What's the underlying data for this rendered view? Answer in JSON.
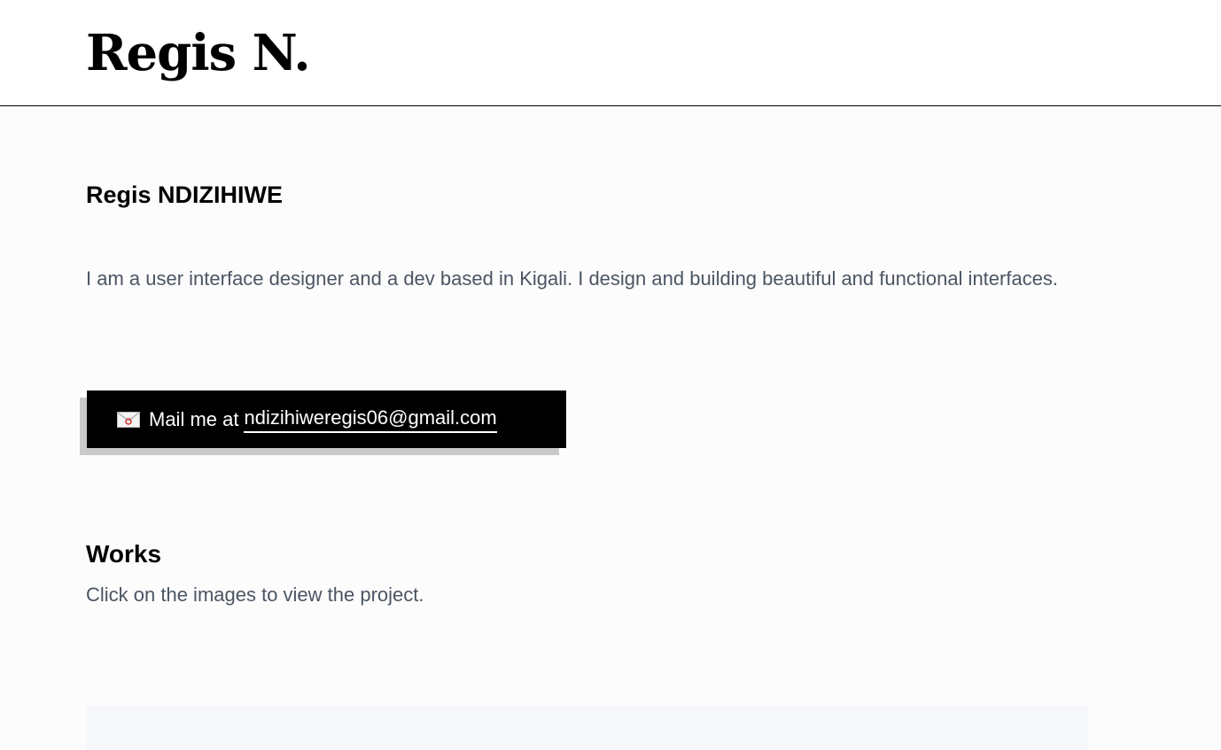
{
  "header": {
    "logo": "Regis N."
  },
  "intro": {
    "name": "Regis NDIZIHIWE",
    "bio": "I am a user interface designer and a dev based in Kigali. I design and building beautiful and functional interfaces."
  },
  "contact": {
    "icon": "envelope-icon",
    "prefix": "Mail me at",
    "email": "ndizihiweregis06@gmail.com"
  },
  "works": {
    "title": "Works",
    "subtitle": "Click on the images to view the project."
  },
  "colors": {
    "text": "#000000",
    "muted_text": "#4b5563",
    "button_bg": "#000000",
    "button_shadow": "#c9c9c9",
    "page_bg": "#fcfcfc",
    "panel_bg": "#f7f8fb"
  }
}
